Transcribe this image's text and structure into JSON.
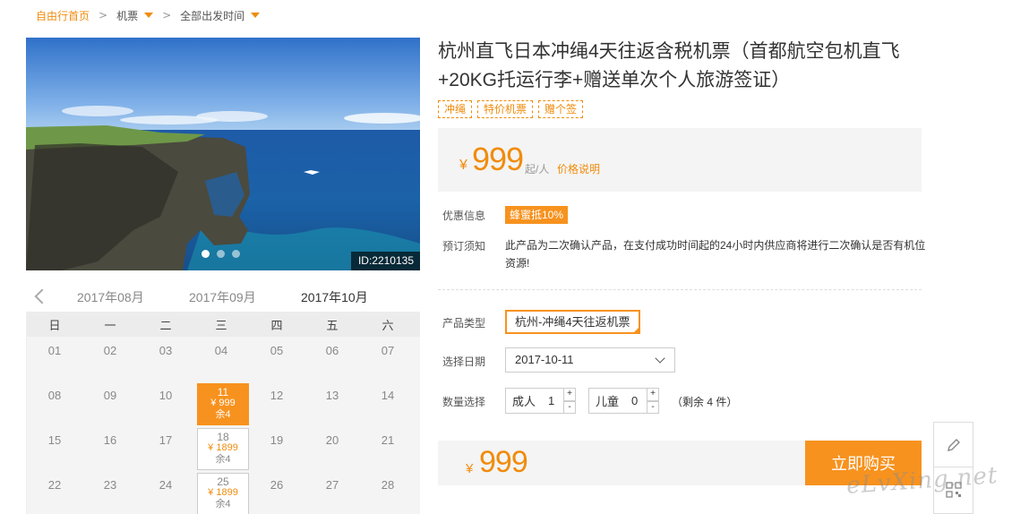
{
  "breadcrumb": {
    "home": "自由行首页",
    "category": "机票",
    "filter": "全部出发时间",
    "separator": ">"
  },
  "hero": {
    "id_label": "ID:2210135",
    "slide_count": 3,
    "active_slide": 1
  },
  "calendar": {
    "months": [
      "2017年08月",
      "2017年09月",
      "2017年10月"
    ],
    "active_month": "2017年10月",
    "weekdays": [
      "日",
      "一",
      "二",
      "三",
      "四",
      "五",
      "六"
    ],
    "days": [
      {
        "num": "01"
      },
      {
        "num": "02"
      },
      {
        "num": "03"
      },
      {
        "num": "04"
      },
      {
        "num": "05"
      },
      {
        "num": "06"
      },
      {
        "num": "07"
      },
      {
        "num": "08"
      },
      {
        "num": "09"
      },
      {
        "num": "10"
      },
      {
        "num": "11",
        "price": "¥ 999",
        "remain": "余4",
        "selected": true
      },
      {
        "num": "12"
      },
      {
        "num": "13"
      },
      {
        "num": "14"
      },
      {
        "num": "15"
      },
      {
        "num": "16"
      },
      {
        "num": "17"
      },
      {
        "num": "18",
        "price": "¥ 1899",
        "remain": "余4"
      },
      {
        "num": "19"
      },
      {
        "num": "20"
      },
      {
        "num": "21"
      },
      {
        "num": "22"
      },
      {
        "num": "23"
      },
      {
        "num": "24"
      },
      {
        "num": "25",
        "price": "¥ 1899",
        "remain": "余4"
      },
      {
        "num": "26"
      },
      {
        "num": "27"
      },
      {
        "num": "28"
      }
    ]
  },
  "product": {
    "title": "杭州直飞日本冲绳4天往返含税机票（首都航空包机直飞+20KG托运行李+赠送单次个人旅游签证）",
    "tags": [
      "冲绳",
      "特价机票",
      "赠个签"
    ],
    "price_symbol": "¥",
    "price": "999",
    "price_unit": "起/人",
    "price_explain": "价格说明"
  },
  "info": {
    "promo_label": "优惠信息",
    "promo_badge": "蜂蜜抵10%",
    "notice_label": "预订须知",
    "notice_text": "此产品为二次确认产品，在支付成功时间起的24小时内供应商将进行二次确认是否有机位资源!"
  },
  "options": {
    "type_label": "产品类型",
    "type_value": "杭州-冲绳4天往返机票",
    "date_label": "选择日期",
    "date_value": "2017-10-11",
    "qty_label": "数量选择",
    "adult_label": "成人",
    "adult_value": "1",
    "child_label": "儿童",
    "child_value": "0",
    "plus": "+",
    "minus": "-",
    "remaining": "（剩余 4 件）"
  },
  "buy": {
    "price_symbol": "¥",
    "total": "999",
    "button": "立即购买"
  },
  "watermark": "eLvXing.net",
  "colors": {
    "accent": "#f7921e",
    "accent_text": "#f08c0d",
    "panel_bg": "#f4f4f4"
  },
  "icons": {
    "edit": "pencil-icon",
    "qr": "qr-code-icon"
  }
}
